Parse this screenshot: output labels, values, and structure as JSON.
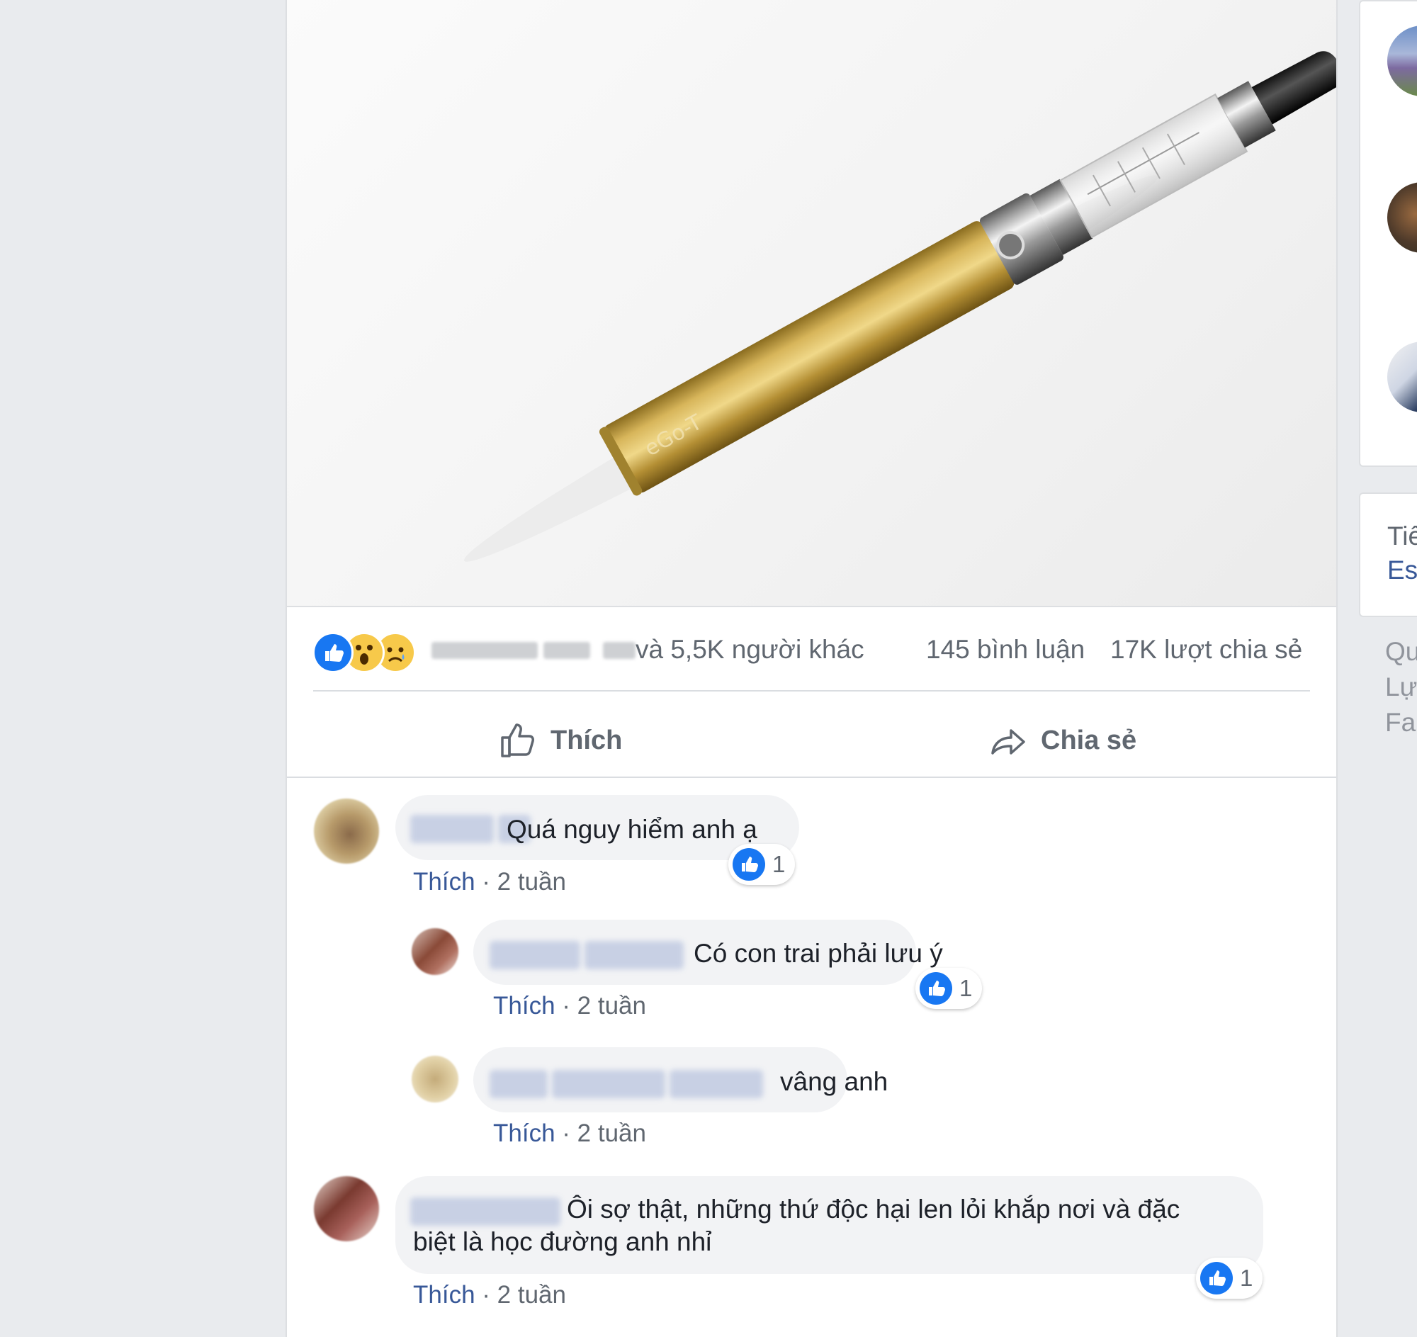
{
  "post": {
    "photo": {
      "brand_text": "eGo-T",
      "alt": ""
    },
    "stats": {
      "others_text": "và 5,5K người khác",
      "comments_text": "145 bình luận",
      "shares_text": "17K lượt chia sẻ"
    },
    "actions": {
      "like_label": "Thích",
      "share_label": "Chia sẻ"
    }
  },
  "comments": [
    {
      "text": "Quá nguy hiểm anh ạ",
      "like_label": "Thích",
      "time": "2 tuần",
      "reaction_count": "1"
    },
    {
      "text": "Có con trai phải lưu ý",
      "like_label": "Thích",
      "time": "2 tuần",
      "reaction_count": "1"
    },
    {
      "text": "vâng anh",
      "like_label": "Thích",
      "time": "2 tuần"
    },
    {
      "text_line1": "Ôi sợ thật, những thứ độc hại len lỏi khắp nơi và đặc",
      "text_line2": "biệt là học đường anh nhỉ",
      "like_label": "Thích",
      "time": "2 tuần",
      "reaction_count": "1"
    }
  ],
  "meta_separator": "·",
  "sidebar": {
    "card_text_line1": "Tiế",
    "card_link_line2": "Esp",
    "footer_line1": "Qu",
    "footer_line2": "Lự",
    "footer_line3": "Fa"
  },
  "colors": {
    "background": "#e9ebee",
    "link_blue": "#385898",
    "like_blue": "#1877f2",
    "text_gray": "#606770",
    "bubble": "#f2f3f5"
  }
}
